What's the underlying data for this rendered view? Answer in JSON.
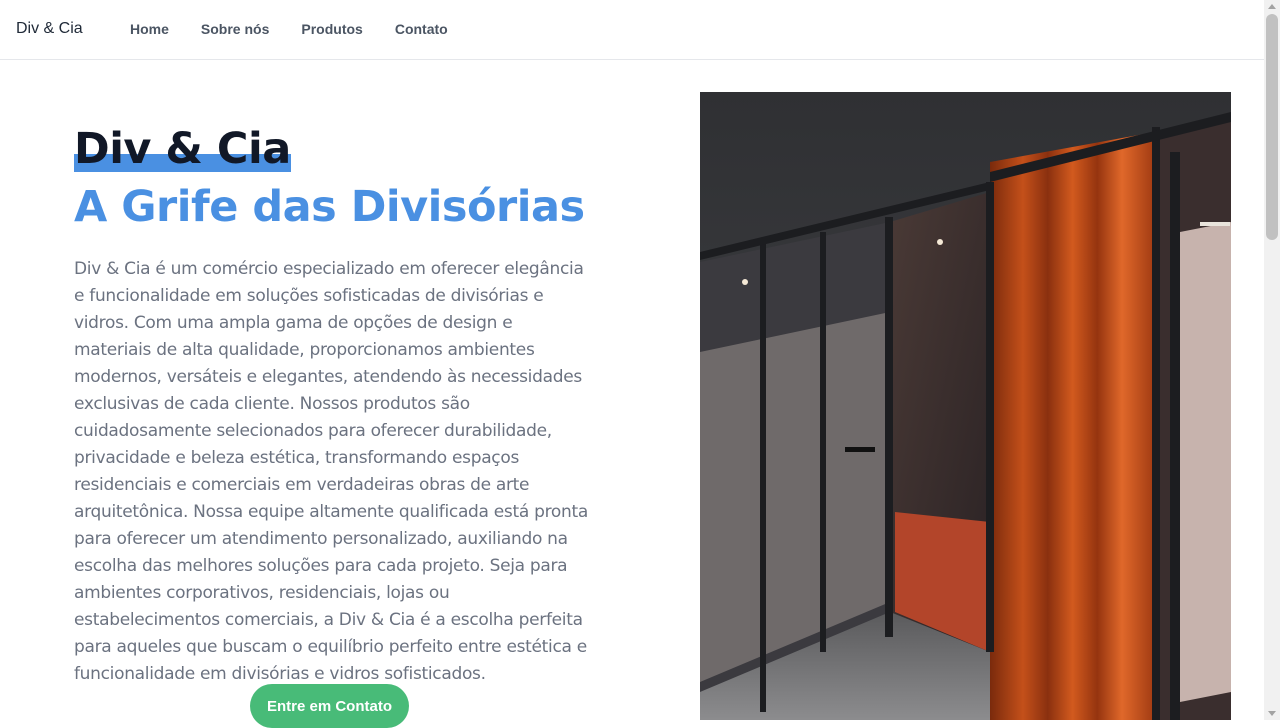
{
  "nav": {
    "brand": "Div & Cia",
    "links": [
      "Home",
      "Sobre nós",
      "Produtos",
      "Contato"
    ]
  },
  "hero": {
    "title_line1": "Div & Cia",
    "title_line2": "A Grife das Divisórias",
    "description": "Div & Cia é um comércio especializado em oferecer elegância e funcionalidade em soluções sofisticadas de divisórias e vidros. Com uma ampla gama de opções de design e materiais de alta qualidade, proporcionamos ambientes modernos, versáteis e elegantes, atendendo às necessidades exclusivas de cada cliente. Nossos produtos são cuidadosamente selecionados para oferecer durabilidade, privacidade e beleza estética, transformando espaços residenciais e comerciais em verdadeiras obras de arte arquitetônica. Nossa equipe altamente qualificada está pronta para oferecer um atendimento personalizado, auxiliando na escolha das melhores soluções para cada projeto. Seja para ambientes corporativos, residenciais, lojas ou estabelecimentos comerciais, a Div & Cia é a escolha perfeita para aqueles que buscam o equilíbrio perfeito entre estética e funcionalidade em divisórias e vidros sofisticados.",
    "cta_label": "Entre em Contato"
  },
  "colors": {
    "accent_blue": "#4a90e2",
    "cta_green": "#48bb78",
    "text_dark": "#111827",
    "text_muted": "#6b7280"
  }
}
